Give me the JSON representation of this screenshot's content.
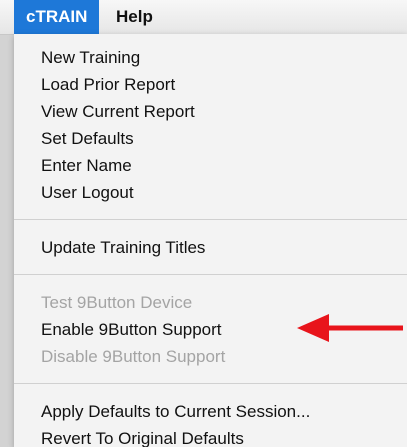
{
  "menubar": {
    "app_menu": "cTRAIN",
    "help_menu": "Help"
  },
  "menu": {
    "group1": [
      {
        "label": "New Training",
        "enabled": true
      },
      {
        "label": "Load Prior Report",
        "enabled": true
      },
      {
        "label": "View Current Report",
        "enabled": true
      },
      {
        "label": "Set Defaults",
        "enabled": true
      },
      {
        "label": "Enter Name",
        "enabled": true
      },
      {
        "label": "User Logout",
        "enabled": true
      }
    ],
    "group2": [
      {
        "label": "Update Training Titles",
        "enabled": true
      }
    ],
    "group3": [
      {
        "label": "Test 9Button Device",
        "enabled": false
      },
      {
        "label": "Enable 9Button Support",
        "enabled": true
      },
      {
        "label": "Disable 9Button Support",
        "enabled": false
      }
    ],
    "group4": [
      {
        "label": "Apply Defaults to Current Session...",
        "enabled": true
      },
      {
        "label": "Revert To Original Defaults",
        "enabled": true
      }
    ]
  },
  "colors": {
    "highlight": "#1e78d8",
    "arrow": "#e8141b",
    "disabled_text": "#a4a4a4"
  },
  "icons": {
    "annotation_arrow": "arrow-left-icon"
  }
}
